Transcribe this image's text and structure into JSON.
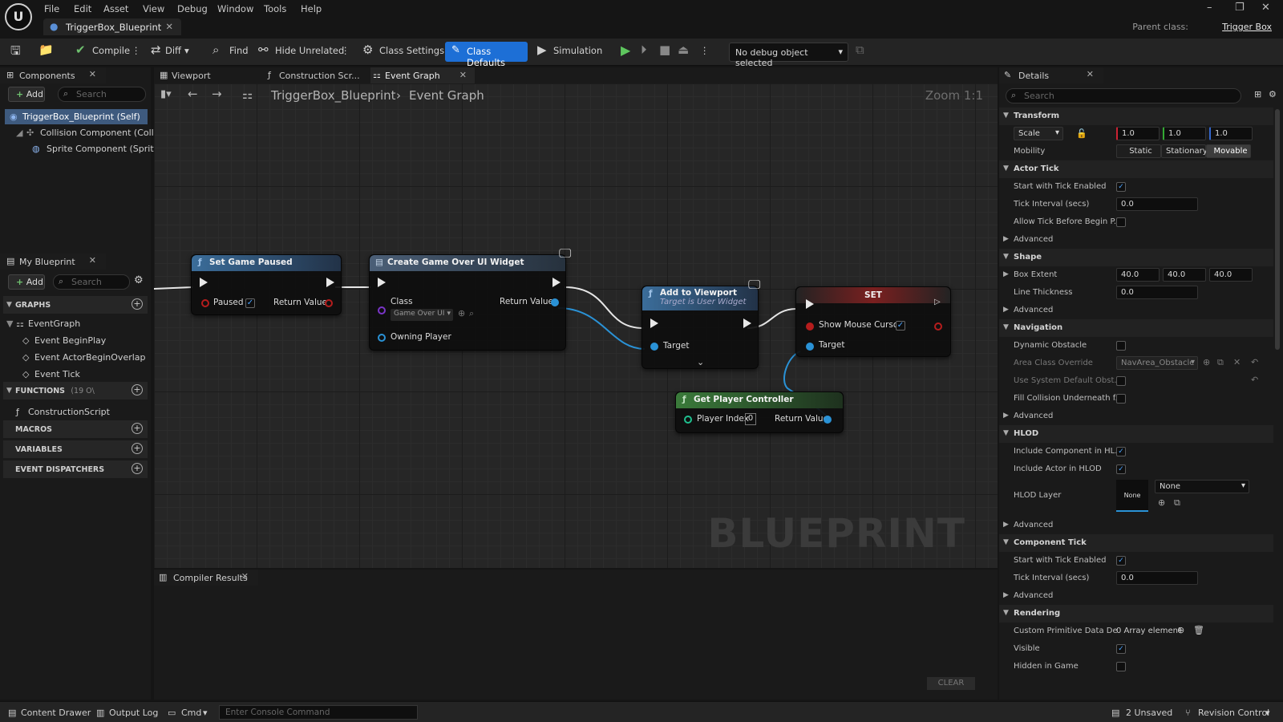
{
  "menu": [
    "File",
    "Edit",
    "Asset",
    "View",
    "Debug",
    "Window",
    "Tools",
    "Help"
  ],
  "logo_text": "U",
  "doc_tab": {
    "title": "TriggerBox_Blueprint"
  },
  "parent_class": {
    "label": "Parent class:",
    "value": "Trigger Box"
  },
  "toolbar": {
    "compile": "Compile",
    "diff": "Diff",
    "find": "Find",
    "hide_unrelated": "Hide Unrelated",
    "class_settings": "Class Settings",
    "class_defaults": "Class Defaults",
    "simulation": "Simulation",
    "debug_object": "No debug object selected"
  },
  "components": {
    "title": "Components",
    "add": "Add",
    "search_placeholder": "Search",
    "items": [
      "TriggerBox_Blueprint (Self)",
      "Collision Component (Collisic",
      "Sprite Component (Sprite)"
    ]
  },
  "my_blueprint": {
    "title": "My Blueprint",
    "add": "Add",
    "search_placeholder": "Search",
    "graphs_label": "GRAPHS",
    "graphs": [
      "EventGraph",
      "Event BeginPlay",
      "Event ActorBeginOverlap",
      "Event Tick"
    ],
    "functions_label": "FUNCTIONS",
    "functions_count": "(19 O\\",
    "functions": [
      "ConstructionScript"
    ],
    "macros_label": "MACROS",
    "variables_label": "VARIABLES",
    "dispatchers_label": "EVENT DISPATCHERS"
  },
  "editor_tabs": [
    "Viewport",
    "Construction Scr...",
    "Event Graph"
  ],
  "breadcrumb": {
    "root": "TriggerBox_Blueprint",
    "current": "Event Graph",
    "zoom": "Zoom 1:1"
  },
  "nodes": {
    "set_game_paused": {
      "title": "Set Game Paused",
      "paused": "Paused",
      "return_value": "Return Value"
    },
    "create_widget": {
      "title": "Create Game Over UI Widget",
      "class": "Class",
      "class_value": "Game Over UI",
      "return_value": "Return Value",
      "owning_player": "Owning Player"
    },
    "add_to_viewport": {
      "title": "Add to Viewport",
      "subtitle": "Target is User Widget",
      "target": "Target"
    },
    "set": {
      "title": "SET",
      "show_mouse_cursor": "Show Mouse Cursor",
      "target": "Target"
    },
    "get_player_controller": {
      "title": "Get Player Controller",
      "player_index": "Player Index",
      "player_index_value": "0",
      "return_value": "Return Value"
    }
  },
  "watermark": "BLUEPRINT",
  "compiler": {
    "title": "Compiler Results",
    "clear": "CLEAR"
  },
  "details": {
    "title": "Details",
    "search_placeholder": "Search",
    "transform": "Transform",
    "scale": "Scale",
    "scale_values": [
      "1.0",
      "1.0",
      "1.0"
    ],
    "mobility": "Mobility",
    "mobility_options": [
      "Static",
      "Stationary",
      "Movable"
    ],
    "actor_tick": "Actor Tick",
    "start_tick": "Start with Tick Enabled",
    "tick_interval": "Tick Interval (secs)",
    "tick_interval_value": "0.0",
    "allow_tick": "Allow Tick Before Begin P...",
    "advanced": "Advanced",
    "shape": "Shape",
    "box_extent": "Box Extent",
    "box_values": [
      "40.0",
      "40.0",
      "40.0"
    ],
    "line_thickness": "Line Thickness",
    "line_thickness_value": "0.0",
    "navigation": "Navigation",
    "dynamic_obstacle": "Dynamic Obstacle",
    "area_class": "Area Class Override",
    "area_class_value": "NavArea_Obstacle",
    "use_system": "Use System Default Obst...",
    "fill_collision": "Fill Collision Underneath f...",
    "hlod": "HLOD",
    "include_component": "Include Component in HL...",
    "include_actor": "Include Actor in HLOD",
    "hlod_layer": "HLOD Layer",
    "hlod_thumb": "None",
    "hlod_value": "None",
    "component_tick": "Component Tick",
    "comp_start_tick": "Start with Tick Enabled",
    "comp_tick_interval": "Tick Interval (secs)",
    "comp_tick_value": "0.0",
    "rendering": "Rendering",
    "custom_primitive": "Custom Primitive Data De...",
    "array_elements": "0 Array element",
    "visible": "Visible",
    "hidden_in_game": "Hidden in Game"
  },
  "statusbar": {
    "content_drawer": "Content Drawer",
    "output_log": "Output Log",
    "cmd": "Cmd",
    "console_placeholder": "Enter Console Command",
    "unsaved": "2 Unsaved",
    "revision": "Revision Control"
  }
}
